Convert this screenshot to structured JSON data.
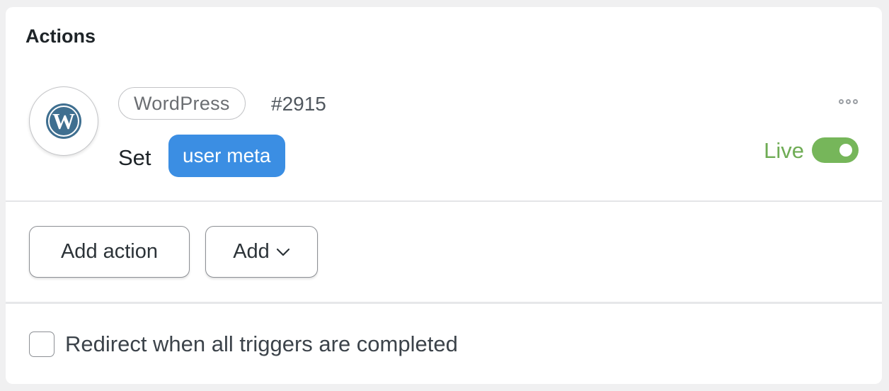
{
  "panel": {
    "title": "Actions"
  },
  "action": {
    "integration": "WordPress",
    "id": "#2915",
    "verb": "Set",
    "token": "user meta",
    "status": "Live",
    "enabled": true,
    "icon": "wordpress-logo-icon"
  },
  "buttons": {
    "add_action": "Add action",
    "add": "Add"
  },
  "redirect": {
    "label": "Redirect when all triggers are completed",
    "checked": false
  },
  "colors": {
    "token_bg": "#3b8ee3",
    "live": "#6fac55",
    "toggle_on": "#76b65a",
    "wordpress_blue": "#3f6f90"
  }
}
